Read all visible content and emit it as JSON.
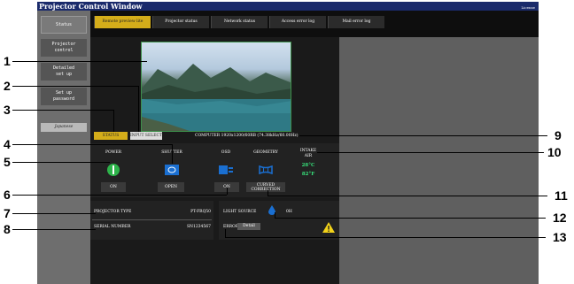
{
  "window": {
    "title": "Projector Control Window",
    "license": "License"
  },
  "sidebar": {
    "items": [
      {
        "label": "Status"
      },
      {
        "label": "Projector control"
      },
      {
        "label": "Detailed set up"
      },
      {
        "label": "Set up password"
      }
    ],
    "language": "Japanese"
  },
  "tabs": [
    {
      "label": "Remote preview lite"
    },
    {
      "label": "Projector status"
    },
    {
      "label": "Network status"
    },
    {
      "label": "Access error log"
    },
    {
      "label": "Mail error log"
    }
  ],
  "preview": {
    "status_label": "STATUS",
    "input_select_label": "INPUT SELECT",
    "input_info": "COMPUTER 1920x1200/60RB (74.38kHz/60.00Hz)"
  },
  "status_panel": {
    "power": {
      "label": "POWER",
      "value": "ON"
    },
    "shutter": {
      "label": "SHUTTER",
      "value": "OPEN"
    },
    "osd": {
      "label": "OSD",
      "value": "ON"
    },
    "geometry": {
      "label": "GEOMETRY",
      "value_line1": "CURVED",
      "value_line2": "CORRECTION"
    },
    "intake_air": {
      "label_line1": "INTAKE",
      "label_line2": "AIR",
      "celsius": "28°C",
      "fahrenheit": "82°F"
    }
  },
  "info": {
    "projector_type_label": "PROJECTOR TYPE",
    "projector_type_value": "PT-FRQ50",
    "serial_label": "SERIAL NUMBER",
    "serial_value": "SN1234567"
  },
  "error_panel": {
    "light_source_label": "LIGHT SOURCE",
    "light_source_hours": "0H",
    "error_label": "ERROR",
    "detail_label": "Detail"
  },
  "callouts": [
    "1",
    "2",
    "3",
    "4",
    "5",
    "6",
    "7",
    "8",
    "9",
    "10",
    "11",
    "12",
    "13"
  ],
  "colors": {
    "accent": "#d4ad1a",
    "title_bar": "#1a2a6b",
    "power_on": "#2db34a",
    "shutter": "#1a6fd1",
    "temp": "#37e07a",
    "warning": "#f2d21a"
  }
}
